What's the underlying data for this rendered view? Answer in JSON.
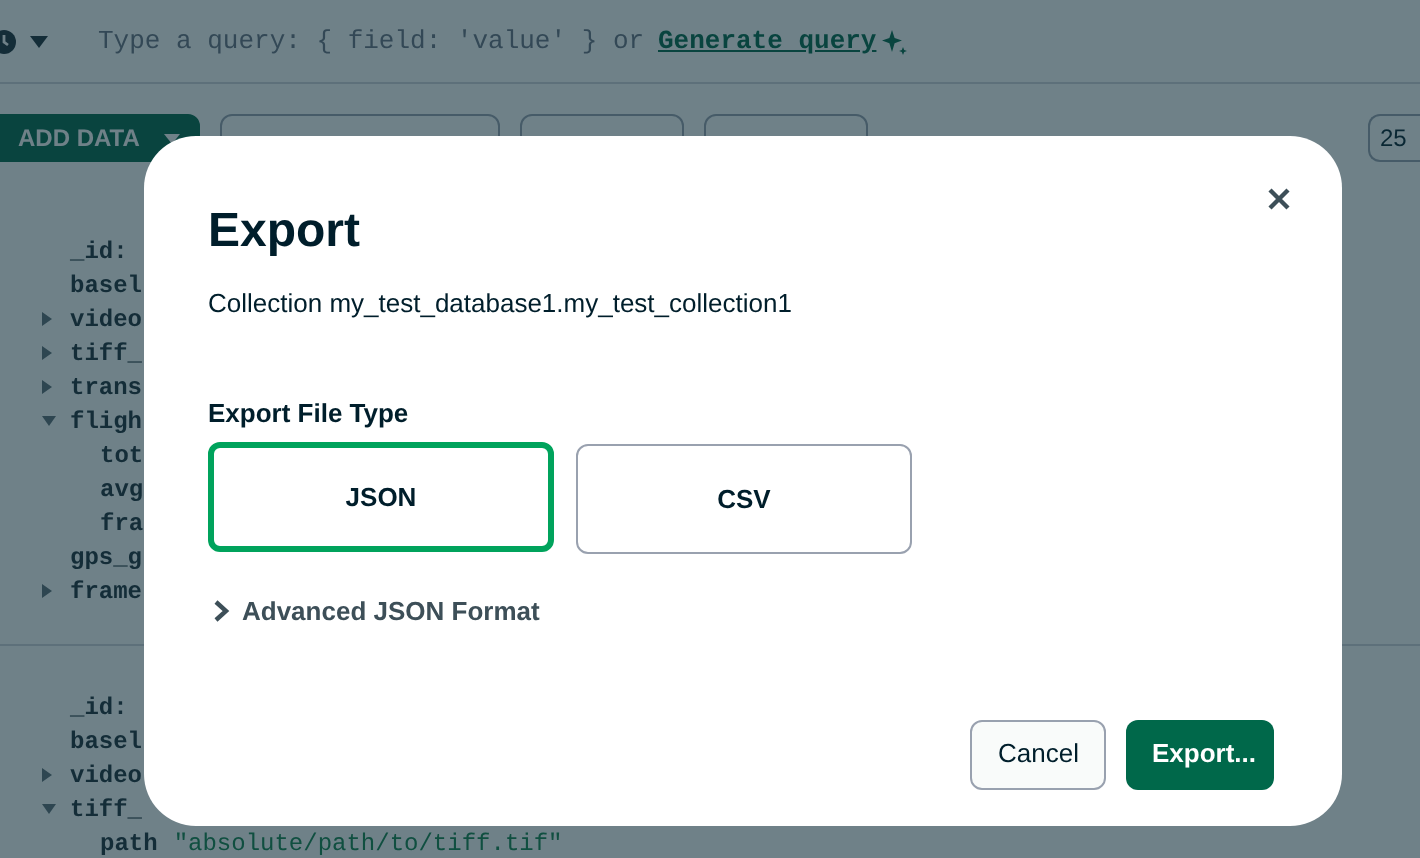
{
  "query_bar": {
    "placeholder": "Type a query: { field: 'value' } or",
    "generate_link": "Generate query"
  },
  "toolbar": {
    "buttons": [
      {
        "label": "ADD DATA",
        "kind": "primary"
      },
      {
        "kind": "outline"
      },
      {
        "kind": "outline"
      },
      {
        "kind": "outline"
      }
    ],
    "page_size": "25"
  },
  "documents": [
    {
      "fields": [
        {
          "kind": "leaf",
          "key": "_id:"
        },
        {
          "kind": "leaf",
          "key": "basel"
        },
        {
          "kind": "node",
          "key": "video",
          "expanded": false
        },
        {
          "kind": "node",
          "key": "tiff_",
          "expanded": false
        },
        {
          "kind": "node",
          "key": "trans",
          "expanded": false
        },
        {
          "kind": "node",
          "key": "fligh",
          "expanded": true,
          "children": [
            {
              "kind": "leaf",
              "key": "tot"
            },
            {
              "kind": "leaf",
              "key": "avg"
            },
            {
              "kind": "leaf",
              "key": "fra"
            }
          ]
        },
        {
          "kind": "leaf",
          "key": "gps_g"
        },
        {
          "kind": "node",
          "key": "frame",
          "expanded": false
        }
      ]
    },
    {
      "fields": [
        {
          "kind": "leaf",
          "key": "_id:"
        },
        {
          "kind": "leaf",
          "key": "basel"
        },
        {
          "kind": "node",
          "key": "video",
          "expanded": false
        },
        {
          "kind": "node",
          "key": "tiff_",
          "expanded": true,
          "children": [
            {
              "kind": "leaf",
              "key": "path",
              "value": "\"absolute/path/to/tiff.tif\""
            }
          ]
        }
      ]
    }
  ],
  "modal": {
    "title": "Export",
    "subtitle": "Collection my_test_database1.my_test_collection1",
    "file_type_label": "Export File Type",
    "options": [
      {
        "label": "JSON",
        "selected": true
      },
      {
        "label": "CSV",
        "selected": false
      }
    ],
    "advanced": {
      "label": "Advanced JSON Format",
      "expanded": false
    },
    "buttons": [
      {
        "label": "Cancel",
        "kind": "secondary"
      },
      {
        "label": "Export...",
        "kind": "primary"
      }
    ]
  }
}
